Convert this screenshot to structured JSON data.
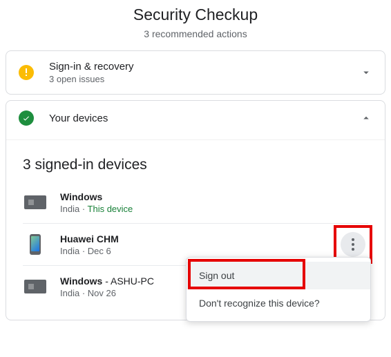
{
  "header": {
    "title": "Security Checkup",
    "subtitle": "3 recommended actions"
  },
  "cards": {
    "signin": {
      "title": "Sign-in & recovery",
      "sub": "3 open issues"
    },
    "devices": {
      "title": "Your devices",
      "section_title": "3 signed-in devices"
    }
  },
  "devices": [
    {
      "name": "Windows",
      "suffix": "",
      "location": "India",
      "sep": " · ",
      "detail": "This device",
      "this_device": true
    },
    {
      "name": "Huawei CHM",
      "suffix": "",
      "location": "India",
      "sep": " · ",
      "detail": "Dec 6",
      "this_device": false
    },
    {
      "name": "Windows",
      "suffix": " - ASHU-PC",
      "location": "India",
      "sep": " · ",
      "detail": "Nov 26",
      "this_device": false
    }
  ],
  "menu": {
    "signout": "Sign out",
    "dont_recognize": "Don't recognize this device?"
  }
}
